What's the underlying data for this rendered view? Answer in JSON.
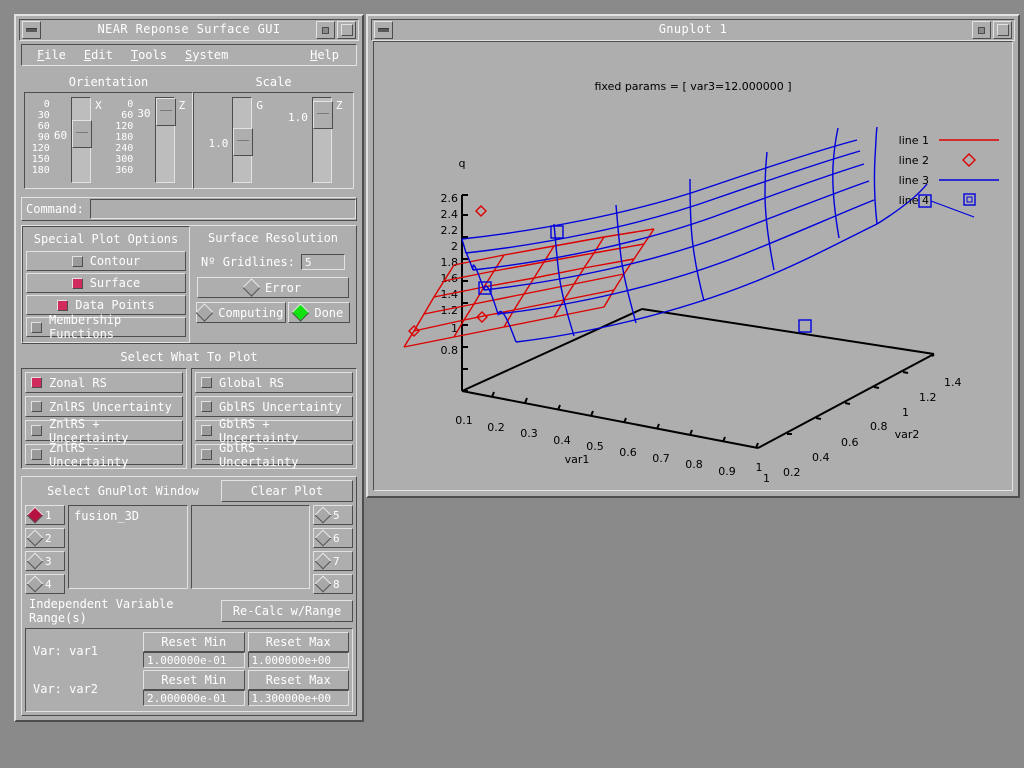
{
  "gui_window": {
    "title": "NEAR Reponse Surface GUI",
    "menu": [
      "File",
      "Edit",
      "Tools",
      "System"
    ],
    "help_label": "Help",
    "orientation": {
      "group_label": "Orientation",
      "sliders": [
        {
          "axis": "X",
          "value": "60",
          "ticks": [
            "0",
            "30",
            "60",
            "90",
            "120",
            "150",
            "180"
          ]
        },
        {
          "axis": "Z",
          "value": "30",
          "ticks": [
            "0",
            "60",
            "120",
            "180",
            "240",
            "300",
            "360"
          ]
        }
      ]
    },
    "scale": {
      "group_label": "Scale",
      "sliders": [
        {
          "axis": "G",
          "value": "1.0"
        },
        {
          "axis": "Z",
          "value": "1.0"
        }
      ]
    },
    "command": {
      "label": "Command:",
      "value": "",
      "placeholder": ""
    },
    "special_plot_options": {
      "title": "Special Plot Options",
      "items": [
        {
          "label": "Contour",
          "checked": false
        },
        {
          "label": "Surface",
          "checked": true
        },
        {
          "label": "Data Points",
          "checked": true
        },
        {
          "label": "Membership Functions",
          "checked": false
        }
      ]
    },
    "surface_resolution": {
      "title": "Surface Resolution",
      "gridlines_label": "Nº Gridlines:",
      "gridlines_value": "5",
      "error_label": "Error",
      "computing_label": "Computing",
      "done_label": "Done",
      "done_active": true,
      "error_active": false,
      "computing_active": false
    },
    "select_what_to_plot": {
      "title": "Select What To Plot",
      "left": [
        {
          "label": "Zonal RS",
          "checked": true
        },
        {
          "label": "ZnlRS Uncertainty",
          "checked": false
        },
        {
          "label": "ZnlRS + Uncertainty",
          "checked": false
        },
        {
          "label": "ZnlRS - Uncertainty",
          "checked": false
        }
      ],
      "right": [
        {
          "label": "Global RS",
          "checked": false
        },
        {
          "label": "GblRS Uncertainty",
          "checked": false
        },
        {
          "label": "GblRS + Uncertainty",
          "checked": false
        },
        {
          "label": "GblRS - Uncertainty",
          "checked": false
        }
      ]
    },
    "gnuplot_window": {
      "title": "Select GnuPlot Window",
      "clear_label": "Clear Plot",
      "left_radios": [
        {
          "label": "1",
          "selected": true
        },
        {
          "label": "2",
          "selected": false
        },
        {
          "label": "3",
          "selected": false
        },
        {
          "label": "4",
          "selected": false
        }
      ],
      "right_radios": [
        {
          "label": "5",
          "selected": false
        },
        {
          "label": "6",
          "selected": false
        },
        {
          "label": "7",
          "selected": false
        },
        {
          "label": "8",
          "selected": false
        }
      ],
      "list_left": "fusion_3D",
      "list_right": ""
    },
    "independent_ranges": {
      "title": "Independent Variable Range(s)",
      "recalc_label": "Re-Calc w/Range",
      "reset_min_label": "Reset Min",
      "reset_max_label": "Reset Max",
      "vars": [
        {
          "name": "Var: var1",
          "min": "1.000000e-01",
          "max": "1.000000e+00"
        },
        {
          "name": "Var: var2",
          "min": "2.000000e-01",
          "max": "1.300000e+00"
        }
      ]
    }
  },
  "gnuplot_window": {
    "title": "Gnuplot 1"
  },
  "chart_data": {
    "type": "line",
    "title": "fixed params = [ var3=12.000000 ]",
    "projection": "3d-surface-mesh",
    "xlabel": "var1",
    "ylabel": "var2",
    "zlabel": "q",
    "xticks": [
      "0.1",
      "0.2",
      "0.3",
      "0.4",
      "0.5",
      "0.6",
      "0.7",
      "0.8",
      "0.9",
      "1"
    ],
    "yticks": [
      "0.2",
      "0.4",
      "0.6",
      "0.8",
      "1",
      "1.2",
      "1.4"
    ],
    "zticks": [
      "0.8",
      "1",
      "1.2",
      "1.4",
      "1.6",
      "1.8",
      "2",
      "2.2",
      "2.4",
      "2.6"
    ],
    "xlim": [
      0.1,
      1.0
    ],
    "ylim": [
      0.2,
      1.4
    ],
    "zlim": [
      0.8,
      2.6
    ],
    "grid": false,
    "legend_position": "top-right",
    "legend": [
      {
        "name": "line 1",
        "style": "line",
        "color": "#dd0000"
      },
      {
        "name": "line 2",
        "style": "diamond",
        "color": "#dd0000"
      },
      {
        "name": "line 3",
        "style": "line",
        "color": "#0000dd"
      },
      {
        "name": "line 4",
        "style": "square",
        "color": "#0000dd"
      }
    ],
    "series": [
      {
        "name": "line 1",
        "color": "#dd0000",
        "kind": "surface-mesh",
        "description": "Zonal RS red mesh surface, lower-left region"
      },
      {
        "name": "line 2",
        "color": "#dd0000",
        "kind": "data-points",
        "description": "red diamond markers on red mesh"
      },
      {
        "name": "line 3",
        "color": "#0000dd",
        "kind": "surface-mesh",
        "description": "blue mesh surface spanning the grid"
      },
      {
        "name": "line 4",
        "color": "#0000dd",
        "kind": "data-points",
        "description": "blue square markers on blue mesh"
      }
    ]
  }
}
